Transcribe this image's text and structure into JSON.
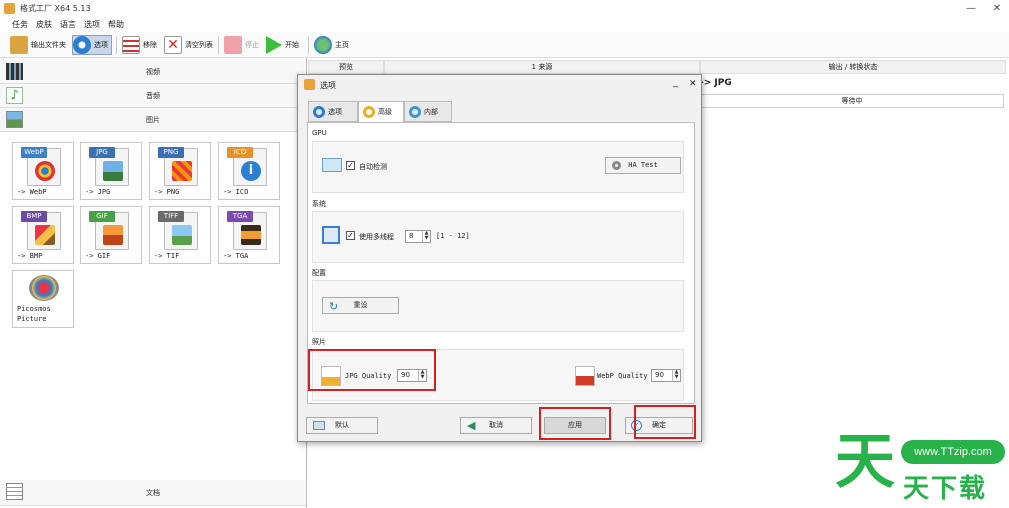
{
  "window": {
    "title": "格式工厂 X64 5.13",
    "minimize": "—",
    "close": "✕"
  },
  "menu": [
    "任务",
    "皮肤",
    "语言",
    "选项",
    "帮助"
  ],
  "toolbar": {
    "output_folder": "输出文件夹",
    "options": "选项",
    "remove": "移除",
    "clear_list": "清空列表",
    "stop": "停止",
    "start": "开始",
    "homepage": "主页"
  },
  "left": {
    "categories": {
      "video": "视频",
      "audio": "音频",
      "image": "图片",
      "document": "文档"
    },
    "formats": [
      {
        "tag": "WebP",
        "label": "-> WebP",
        "tag_color": "#3c7fc9",
        "pic": "chrome-icon"
      },
      {
        "tag": "JPG",
        "label": "-> JPG",
        "tag_color": "#3c6fb0",
        "pic": "landscape-icon"
      },
      {
        "tag": "PNG",
        "label": "-> PNG",
        "tag_color": "#3a6fb8",
        "pic": "pattern-icon"
      },
      {
        "tag": "ICO",
        "label": "-> ICO",
        "tag_color": "#e8902a",
        "pic": "info-icon"
      },
      {
        "tag": "BMP",
        "label": "-> BMP",
        "tag_color": "#6a4ca8",
        "pic": "paint-icon"
      },
      {
        "tag": "GIF",
        "label": "-> GIF",
        "tag_color": "#4aa04a",
        "pic": "sunset-icon"
      },
      {
        "tag": "TIFF",
        "label": "-> TIF",
        "tag_color": "#6a6a6a",
        "pic": "landscape-icon"
      },
      {
        "tag": "TGA",
        "label": "-> TGA",
        "tag_color": "#7a4ab0",
        "pic": "picture-icon"
      }
    ],
    "picosmos": {
      "line1": "Picosmos",
      "line2": "Picture"
    }
  },
  "right": {
    "headers": {
      "preview": "预览",
      "source": "1 来源",
      "output": "输出 / 转换状态"
    },
    "row": {
      "output": "-> JPG",
      "status": "等待中"
    }
  },
  "dialog": {
    "title": "选项",
    "min": "_",
    "close": "✕",
    "tabs": [
      "选项",
      "高级",
      "内部"
    ],
    "gpu": {
      "title": "GPU",
      "auto_detect": "自动检测",
      "ha_test": "HA Test"
    },
    "system": {
      "title": "系统",
      "multithread": "使用多线程",
      "threads": "8",
      "range": "[1 - 12]"
    },
    "config": {
      "title": "配置",
      "reset": "重设"
    },
    "photo": {
      "title": "照片",
      "jpg_quality_label": "JPG Quality",
      "jpg_quality": "90",
      "webp_quality_label": "WebP Quality",
      "webp_quality": "90"
    },
    "buttons": {
      "default": "默认",
      "cancel": "取消",
      "apply": "应用",
      "ok": "确定"
    }
  },
  "watermark": {
    "big": "天",
    "url": "www.TTzip.com",
    "sub": "天下载"
  }
}
